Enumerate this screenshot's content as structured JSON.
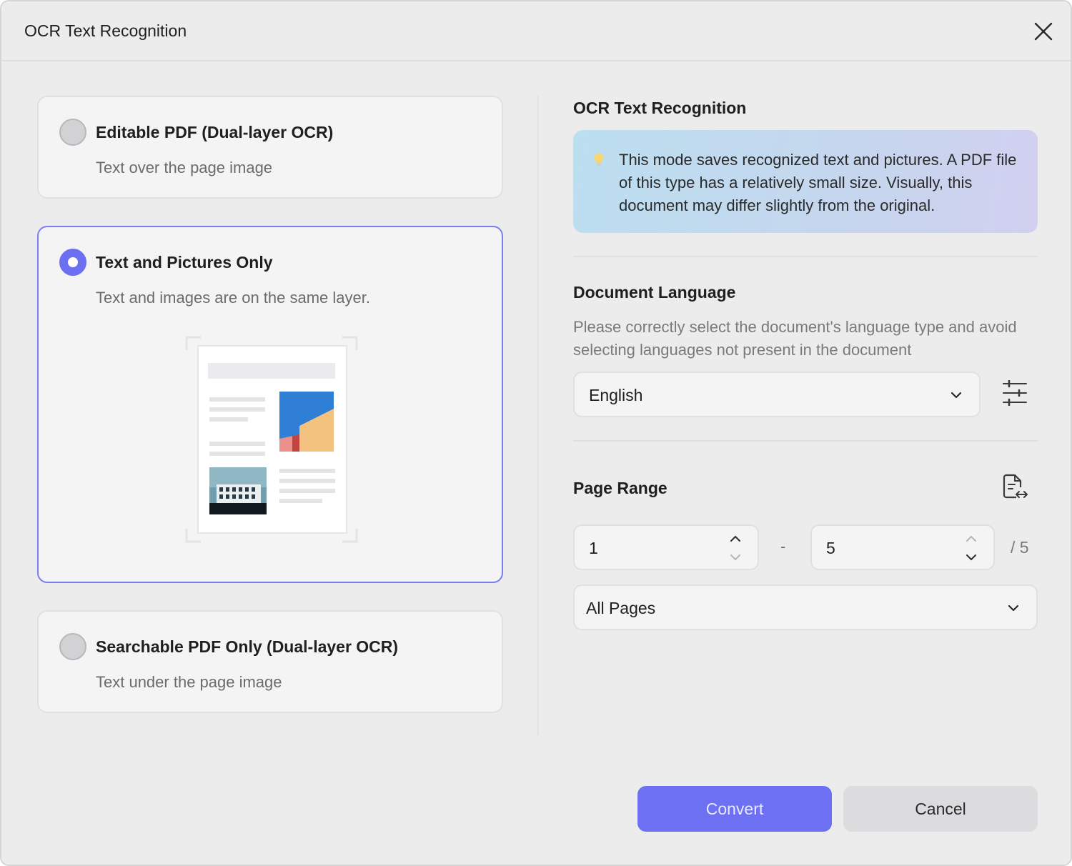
{
  "dialog": {
    "title": "OCR Text Recognition"
  },
  "options": [
    {
      "title": "Editable PDF (Dual-layer OCR)",
      "subtitle": "Text over the page image",
      "selected": false
    },
    {
      "title": "Text and Pictures Only",
      "subtitle": "Text and images are on the same layer.",
      "selected": true
    },
    {
      "title": "Searchable PDF Only (Dual-layer OCR)",
      "subtitle": "Text under the page image",
      "selected": false
    }
  ],
  "ocr_section": {
    "title": "OCR Text Recognition",
    "tip": "This mode saves recognized text and pictures. A PDF file of this type has a relatively small size. Visually, this document may differ slightly from the original."
  },
  "language_section": {
    "title": "Document Language",
    "description": "Please correctly select the document's language type and avoid selecting languages not present in the document",
    "selected_language": "English"
  },
  "page_range": {
    "title": "Page Range",
    "from": "1",
    "dash": "-",
    "to": "5",
    "total": "/ 5",
    "range_option": "All Pages"
  },
  "buttons": {
    "convert": "Convert",
    "cancel": "Cancel"
  },
  "colors": {
    "accent": "#6d70f3",
    "selected_border": "#7b7ef0",
    "background": "#ececec",
    "card": "#f4f4f5"
  },
  "icons": {
    "close": "close-icon",
    "bulb": "lightbulb-icon",
    "chevron": "chevron-down-icon",
    "settings": "sliders-icon",
    "swap": "page-swap-icon"
  }
}
